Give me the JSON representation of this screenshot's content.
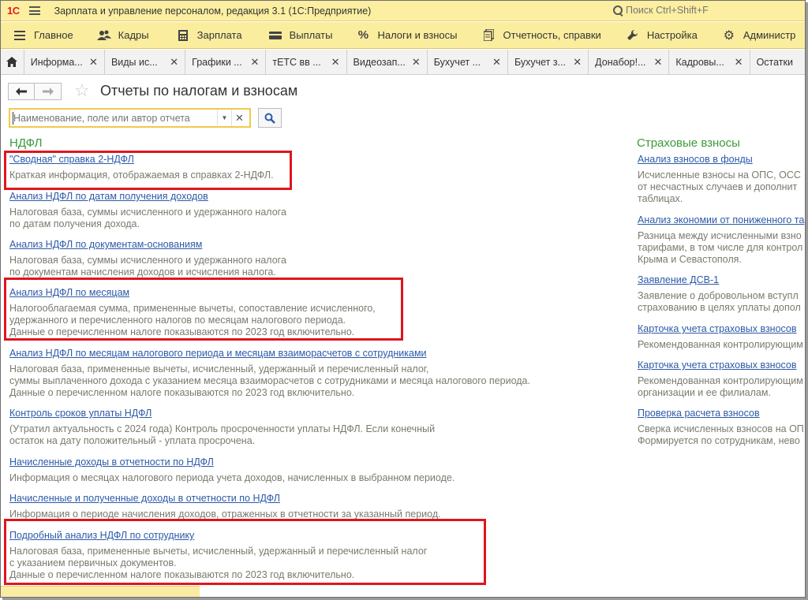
{
  "app": {
    "logo": "1С",
    "title": "Зарплата и управление персоналом, редакция 3.1  (1С:Предприятие)",
    "search_placeholder": "Поиск Ctrl+Shift+F"
  },
  "menu": [
    {
      "label": "Главное",
      "icon": "hamburger-menu-icon"
    },
    {
      "label": "Кадры",
      "icon": "people-icon"
    },
    {
      "label": "Зарплата",
      "icon": "calculator-icon"
    },
    {
      "label": "Выплаты",
      "icon": "wallet-icon"
    },
    {
      "label": "Налоги и взносы",
      "icon": "percent-icon"
    },
    {
      "label": "Отчетность, справки",
      "icon": "reports-icon"
    },
    {
      "label": "Настройка",
      "icon": "wrench-icon"
    },
    {
      "label": "Администр",
      "icon": "gear-icon"
    }
  ],
  "tabs": [
    {
      "label": "Информа..."
    },
    {
      "label": "Виды ис..."
    },
    {
      "label": "Графики ..."
    },
    {
      "label": "тЕТС вв ..."
    },
    {
      "label": "Видеозап..."
    },
    {
      "label": "Бухучет ..."
    },
    {
      "label": "Бухучет з..."
    },
    {
      "label": "Донабор!..."
    },
    {
      "label": "Кадровы..."
    },
    {
      "label": "Остатки"
    }
  ],
  "page": {
    "title": "Отчеты по налогам и взносам",
    "search_placeholder": "Наименование, поле или автор отчета"
  },
  "ndfl": {
    "title": "НДФЛ",
    "reports": [
      {
        "link": "\"Сводная\" справка 2-НДФЛ",
        "desc": [
          "Краткая информация, отображаемая в справках 2-НДФЛ."
        ]
      },
      {
        "link": "Анализ НДФЛ по датам получения доходов",
        "desc": [
          "Налоговая база, суммы исчисленного и удержанного налога",
          "по датам получения дохода."
        ]
      },
      {
        "link": "Анализ НДФЛ по документам-основаниям",
        "desc": [
          "Налоговая база, суммы исчисленного и удержанного налога",
          "по документам начисления доходов и исчисления налога."
        ]
      },
      {
        "link": "Анализ НДФЛ по месяцам",
        "desc": [
          "Налогооблагаемая сумма, примененные вычеты, сопоставление исчисленного,",
          "удержанного и перечисленного налогов по месяцам налогового периода.",
          "Данные о перечисленном налоге показываются по 2023 год включительно."
        ]
      },
      {
        "link": "Анализ НДФЛ по месяцам налогового периода и месяцам взаиморасчетов с сотрудниками",
        "desc": [
          "Налоговая база, примененные вычеты, исчисленный, удержанный и перечисленный налог,",
          "суммы выплаченного дохода с указанием месяца взаиморасчетов с сотрудниками и месяца налогового периода.",
          "Данные о перечисленном налоге показываются по 2023 год включительно."
        ]
      },
      {
        "link": "Контроль сроков уплаты НДФЛ",
        "desc": [
          "(Утратил актуальность с 2024 года) Контроль просроченности уплаты НДФЛ. Если конечный",
          "остаток на дату положительный - уплата просрочена."
        ]
      },
      {
        "link": "Начисленные доходы в отчетности по НДФЛ",
        "desc": [
          "Информация о месяцах налогового периода учета доходов, начисленных в выбранном периоде."
        ]
      },
      {
        "link": "Начисленные и полученные доходы в отчетности по НДФЛ",
        "desc": [
          "Информация о периоде начисления доходов, отраженных в отчетности за указанный период."
        ]
      },
      {
        "link": "Подробный анализ НДФЛ по сотруднику",
        "desc": [
          "Налоговая база, примененные вычеты, исчисленный, удержанный и перечисленный налог",
          "с указанием первичных документов.",
          "Данные о перечисленном налоге показываются по 2023 год включительно."
        ]
      }
    ]
  },
  "insurance": {
    "title": "Страховые взносы",
    "reports": [
      {
        "link": "Анализ взносов в фонды",
        "desc": [
          "Исчисленные взносы на ОПС, ОСС",
          "от несчастных случаев и дополнит",
          "таблицах."
        ]
      },
      {
        "link": "Анализ экономии от пониженного та",
        "desc": [
          "Разница между исчисленными взно",
          "тарифами, в том числе для контрол",
          "Крыма и Севастополя."
        ]
      },
      {
        "link": "Заявление ДСВ-1",
        "desc": [
          "Заявление о добровольном вступл",
          "страхованию в целях уплаты допол"
        ]
      },
      {
        "link": "Карточка учета страховых взносов",
        "desc": [
          "Рекомендованная контролирующим"
        ]
      },
      {
        "link": "Карточка учета страховых взносов",
        "desc": [
          "Рекомендованная контролирующим",
          "организации и ее филиалам."
        ]
      },
      {
        "link": "Проверка расчета взносов",
        "desc": [
          "Сверка исчисленных взносов на ОП",
          "Формируется по сотрудникам, нево"
        ]
      }
    ]
  }
}
